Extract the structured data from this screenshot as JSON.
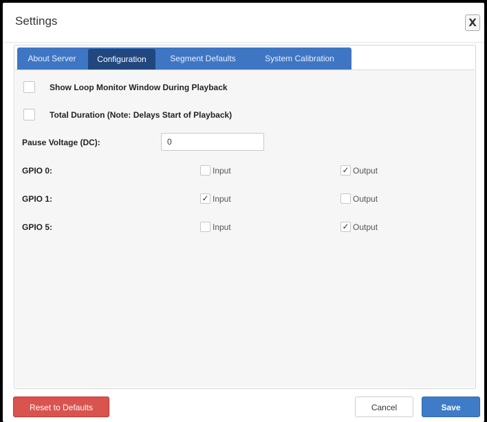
{
  "dialog": {
    "title": "Settings",
    "close_label": "X"
  },
  "tabs": [
    {
      "label": "About Server",
      "active": false
    },
    {
      "label": "Configuration",
      "active": true
    },
    {
      "label": "Segment Defaults",
      "active": false
    },
    {
      "label": "System Calibration",
      "active": false
    }
  ],
  "config": {
    "show_loop_monitor": {
      "label": "Show Loop Monitor Window During Playback",
      "checked": false
    },
    "total_duration": {
      "label": "Total Duration (Note: Delays Start of Playback)",
      "checked": false
    },
    "pause_voltage": {
      "label": "Pause Voltage (DC):",
      "value": "0"
    },
    "gpio": [
      {
        "label": "GPIO 0:",
        "input_label": "Input",
        "input_checked": false,
        "output_label": "Output",
        "output_checked": true
      },
      {
        "label": "GPIO 1:",
        "input_label": "Input",
        "input_checked": true,
        "output_label": "Output",
        "output_checked": false
      },
      {
        "label": "GPIO 5:",
        "input_label": "Input",
        "input_checked": false,
        "output_label": "Output",
        "output_checked": true
      }
    ]
  },
  "footer": {
    "reset_label": "Reset to Defaults",
    "cancel_label": "Cancel",
    "save_label": "Save"
  },
  "colors": {
    "tab_bar": "#3e76c3",
    "tab_active": "#21477e",
    "reset": "#d9534f",
    "save": "#3f7cc8"
  }
}
